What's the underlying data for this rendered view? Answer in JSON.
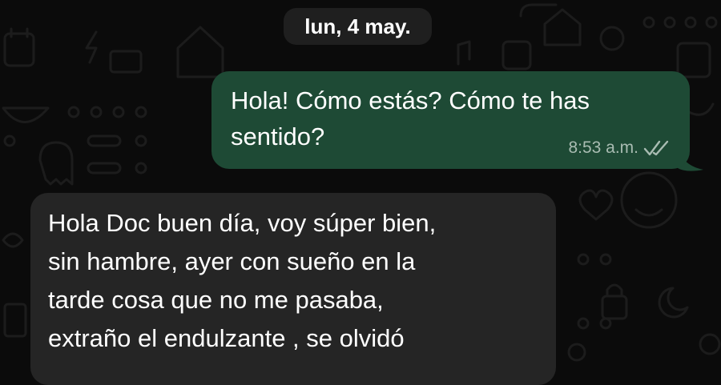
{
  "chat": {
    "date_separator": "lun, 4 may.",
    "outgoing": {
      "lines": [
        "Hola! Cómo estás? Cómo te has",
        "sentido?"
      ],
      "time": "8:53 a.m.",
      "status_icon": "double-check-icon"
    },
    "incoming": {
      "lines": [
        "Hola Doc buen día, voy súper bien,",
        "sin hambre, ayer con sueño en la",
        "tarde cosa que no me pasaba,",
        "extraño el endulzante , se olvidó"
      ]
    }
  },
  "colors": {
    "background": "#0b0b0b",
    "outgoing_bubble": "#1e4a35",
    "incoming_bubble": "#252525",
    "date_pill": "#1f1f1f",
    "doodle": "#1c1c1c",
    "meta_text": "#a9bcb2"
  }
}
